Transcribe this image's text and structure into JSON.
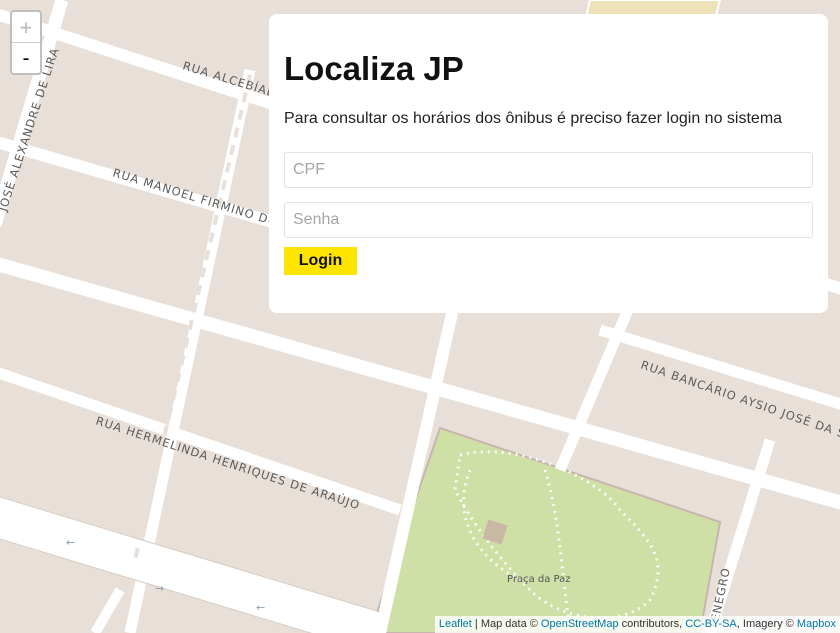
{
  "app": {
    "title": "Localiza JP"
  },
  "map": {
    "streets": [
      "RUA ALCEBÍADES",
      "RUA MANOEL FIRMINO DO",
      "JOSÉ ALEXANDRE DE LIRA",
      "RUA BANCÁRIO AYSIO JOSÉ DA SILVA",
      "RUA HERMELINDA HENRIQUES DE ARAÚJO",
      "TENEGRO"
    ],
    "park_label": "Praça da Paz",
    "colors": {
      "land": "#e8e0d8",
      "road": "#ffffff",
      "park": "#cfe0a6"
    }
  },
  "zoom": {
    "in_label": "+",
    "out_label": "-"
  },
  "login": {
    "title": "Localiza JP",
    "description": "Para consultar os horários dos ônibus é preciso fazer login no sistema",
    "cpf_placeholder": "CPF",
    "password_placeholder": "Senha",
    "button_label": "Login",
    "button_color": "#ffe400"
  },
  "attribution": {
    "leaflet": "Leaflet",
    "sep1": " | Map data © ",
    "osm": "OpenStreetMap",
    "sep2": " contributors, ",
    "license": "CC-BY-SA",
    "sep3": ", Imagery © ",
    "mapbox": "Mapbox"
  }
}
